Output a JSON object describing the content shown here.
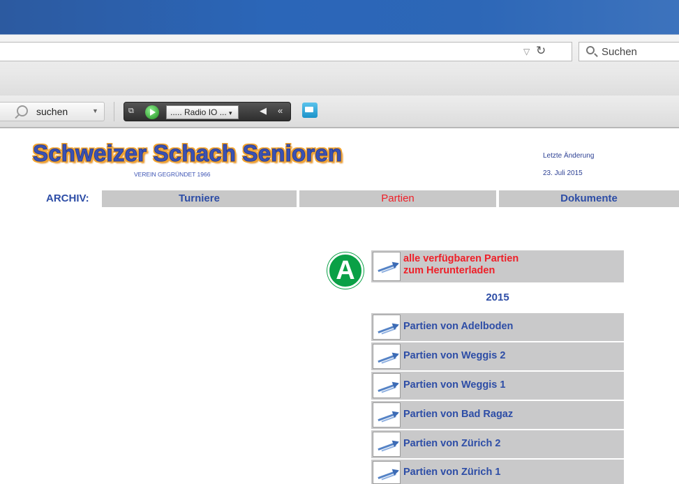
{
  "browser": {
    "search_placeholder": "Suchen",
    "toolbar_search_label": "suchen",
    "radio_station": "..... Radio IO ...",
    "radio_arrow": "▾",
    "radio_back": "«"
  },
  "site": {
    "title": "Schweizer Schach Senioren",
    "subtitle": "VEREIN GEGRÜNDET 1966",
    "last_change_label": "Letzte Änderung",
    "last_change_date": "23. Juli 2015"
  },
  "nav": {
    "label": "ARCHIV:",
    "items": [
      {
        "label": "Turniere",
        "active": false
      },
      {
        "label": "Partien",
        "active": true
      },
      {
        "label": "Dokumente",
        "active": false
      }
    ]
  },
  "download_all": {
    "line1": "alle verfügbaren Partien",
    "line2": "zum Herunterladen"
  },
  "badge": "A",
  "year": "2015",
  "games": [
    "Partien von Adelboden",
    "Partien von Weggis 2",
    "Partien von Weggis 1",
    "Partien von Bad Ragaz",
    "Partien von Zürich 2",
    "Partien von Zürich 1"
  ],
  "colors": {
    "title_bar": "#2b66b8",
    "link_blue": "#2d4da6",
    "active_red": "#ef1f28",
    "row_gray": "#c9c9ca",
    "badge_green": "#0aa046"
  }
}
